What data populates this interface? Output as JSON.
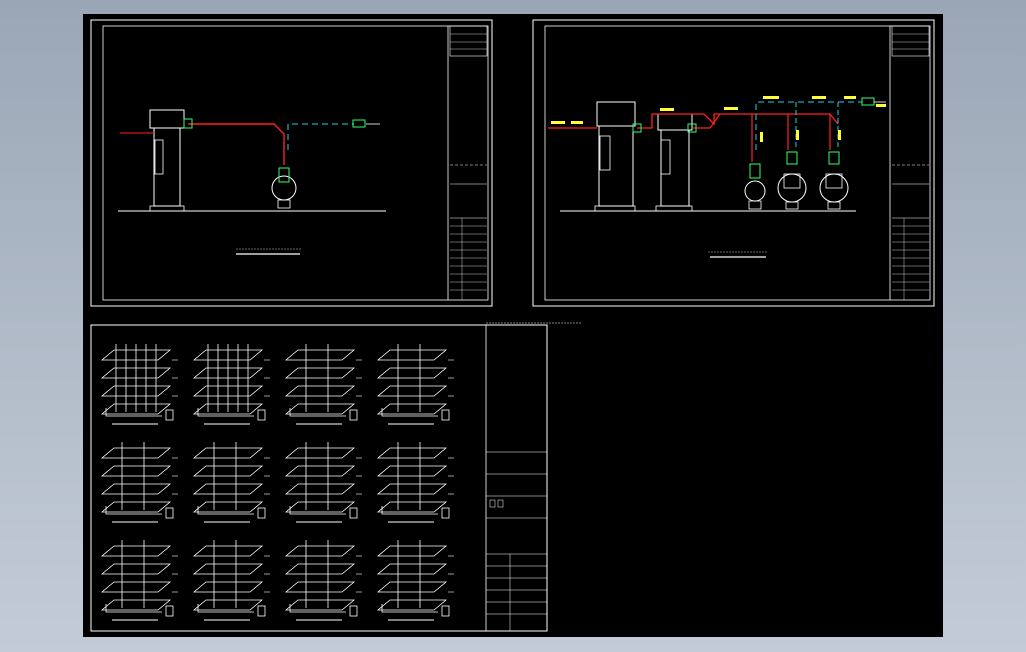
{
  "drawing": {
    "model_space_color": "#000000",
    "background_color": "#aeb8c5",
    "line_colors": {
      "frame": "#ffffff",
      "hot_pipe": "#ff2020",
      "return_pipe": "#19d3e6",
      "label": "#ffff33",
      "device": "#33ff66"
    }
  },
  "sheets": [
    {
      "name": "sheet-1-single-unit",
      "units": 1,
      "pumps": 1
    },
    {
      "name": "sheet-2-double-unit",
      "units": 2,
      "pumps": 3
    },
    {
      "name": "sheet-3-isometric-set",
      "isometric_rows": 3,
      "isometric_cols": 4,
      "title_rows": 7
    }
  ],
  "icons": [
    "water-heater-icon",
    "pump-icon",
    "valve-icon",
    "check-valve-icon"
  ]
}
